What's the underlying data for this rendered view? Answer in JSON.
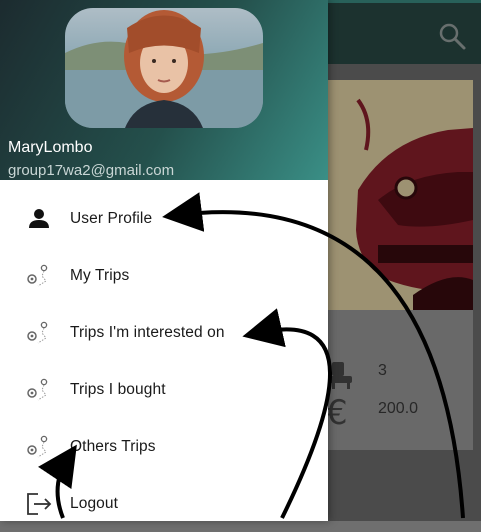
{
  "header": {
    "user_name": "MaryLombo",
    "user_email": "group17wa2@gmail.com"
  },
  "menu": {
    "items": [
      {
        "label": "User Profile",
        "icon": "person-icon"
      },
      {
        "label": "My Trips",
        "icon": "route-pin-icon"
      },
      {
        "label": "Trips I'm interested on",
        "icon": "route-pin-icon"
      },
      {
        "label": "Trips I bought",
        "icon": "route-pin-icon"
      },
      {
        "label": "Others Trips",
        "icon": "route-pin-icon"
      },
      {
        "label": "Logout",
        "icon": "logout-icon"
      }
    ]
  },
  "background": {
    "trip_card": {
      "seats": "3",
      "price": "200.0"
    }
  },
  "colors": {
    "header_gradient_start": "#1c2b2f",
    "header_gradient_end": "#3a8f86",
    "toolbar": "#2a4a46"
  }
}
